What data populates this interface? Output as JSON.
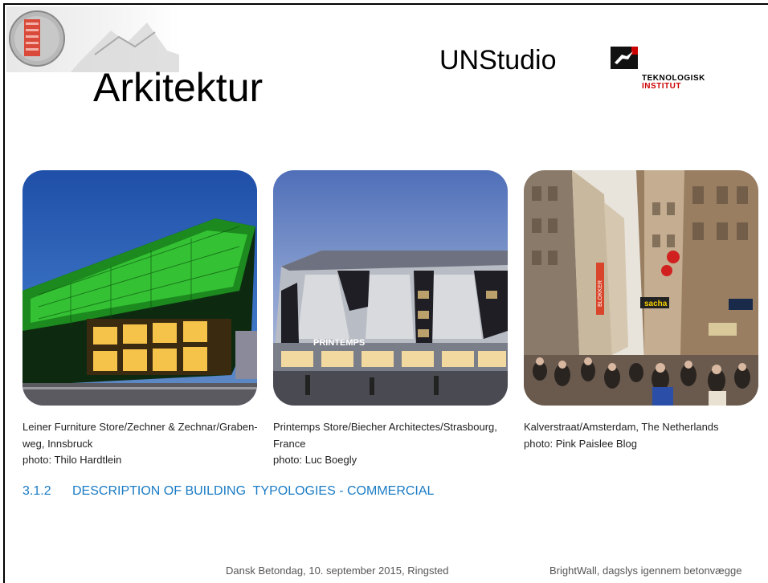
{
  "slide": {
    "title": "Arkitektur",
    "logo_unstudio": "UNStudio",
    "logo_ti_line1": "TEKNOLOGISK",
    "logo_ti_line2": "INSTITUT"
  },
  "photos": [
    {
      "icon": "building-photo",
      "caption_line1": "Leiner Furniture Store/Zechner & Zechnar/Graben-",
      "caption_line2": "weg, Innsbruck",
      "caption_line3": "photo: Thilo Hardtlein"
    },
    {
      "icon": "building-photo",
      "sign": "PRINTEMPS",
      "caption_line1": "Printemps Store/Biecher Architectes/Strasbourg,",
      "caption_line2": "France",
      "caption_line3": "photo: Luc Boegly"
    },
    {
      "icon": "street-photo",
      "sign1": "BLOKKER",
      "sign2": "sacha",
      "caption_line1": "Kalverstraat/Amsterdam, The Netherlands",
      "caption_line2": "photo: Pink Paislee Blog"
    }
  ],
  "section": {
    "number": "3.1.2",
    "label": "DESCRIPTION OF BUILDING  TYPOLOGIES - COMMERCIAL"
  },
  "footer": {
    "left": "Dansk Betondag, 10. september 2015, Ringsted",
    "right": "BrightWall, dagslys igennem betonvægge"
  },
  "colors": {
    "section_blue": "#1a7bc4",
    "ti_red": "#cc0000"
  }
}
